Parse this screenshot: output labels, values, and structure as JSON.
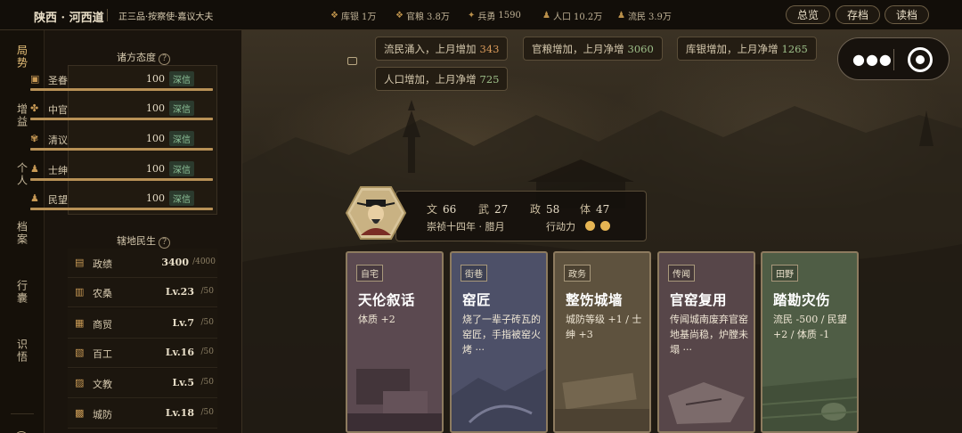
{
  "topbar": {
    "location": "陕西 · 河西道",
    "rank": "正三品·按察使·嘉议大夫",
    "resources": [
      {
        "icon": "coin-icon",
        "label": "库银",
        "value": "1万"
      },
      {
        "icon": "grain-icon",
        "label": "官粮",
        "value": "3.8万"
      },
      {
        "icon": "soldier-icon",
        "label": "兵勇",
        "value": "1590"
      },
      {
        "icon": "people-icon",
        "label": "人口",
        "value": "10.2万"
      },
      {
        "icon": "refugee-icon",
        "label": "流民",
        "value": "3.9万"
      }
    ],
    "buttons": {
      "overview": "总览",
      "save": "存档",
      "load": "读档"
    }
  },
  "nav": [
    "局势",
    "增益",
    "个人",
    "档案",
    "行囊",
    "识悟"
  ],
  "attitudes": {
    "title": "诸方态度",
    "items": [
      {
        "name": "圣眷",
        "value": "100",
        "badge": "深信",
        "level": 1.0
      },
      {
        "name": "中官",
        "value": "100",
        "badge": "深信",
        "level": 1.0
      },
      {
        "name": "清议",
        "value": "100",
        "badge": "深信",
        "level": 1.0
      },
      {
        "name": "士绅",
        "value": "100",
        "badge": "深信",
        "level": 1.0
      },
      {
        "name": "民望",
        "value": "100",
        "badge": "深信",
        "level": 1.0
      }
    ]
  },
  "livelihood": {
    "title": "辖地民生",
    "items": [
      {
        "name": "政绩",
        "value": "3400",
        "max": "/4000"
      },
      {
        "name": "农桑",
        "value": "Lv.23",
        "max": "/50"
      },
      {
        "name": "商贸",
        "value": "Lv.7",
        "max": "/50"
      },
      {
        "name": "百工",
        "value": "Lv.16",
        "max": "/50"
      },
      {
        "name": "文教",
        "value": "Lv.5",
        "max": "/50"
      },
      {
        "name": "城防",
        "value": "Lv.18",
        "max": "/50"
      }
    ]
  },
  "notices": [
    {
      "text": "流民涌入，上月增加",
      "num": "343"
    },
    {
      "text": "官粮增加，上月净增",
      "num": "3060"
    },
    {
      "text": "库银增加，上月净增",
      "num": "1265"
    },
    {
      "text": "人口增加，上月净增",
      "num": "725"
    }
  ],
  "character": {
    "stats": [
      {
        "label": "文",
        "value": "66"
      },
      {
        "label": "武",
        "value": "27"
      },
      {
        "label": "政",
        "value": "58"
      },
      {
        "label": "体",
        "value": "47"
      }
    ],
    "date": "崇祯十四年 · 腊月",
    "action_label": "行动力",
    "action_points": 2
  },
  "cards": [
    {
      "tag": "自宅",
      "title": "天伦叙话",
      "desc": "体质 +2",
      "color": "#5b4950"
    },
    {
      "tag": "街巷",
      "title": "窑匠",
      "desc": "烧了一辈子砖瓦的窑匠，手指被窑火烤 ···",
      "color": "#4d5068"
    },
    {
      "tag": "政务",
      "title": "整饬城墙",
      "desc": "城防等级 +1 / 士绅 +3",
      "color": "#5e523e"
    },
    {
      "tag": "传闻",
      "title": "官窑复用",
      "desc": "传闻城南废弃官窑地基尚稳，炉膛未塌 ···",
      "color": "#574649"
    },
    {
      "tag": "田野",
      "title": "踏勘灾伤",
      "desc": "流民 -500 / 民望 +2 / 体质 -1",
      "color": "#4f5d45"
    }
  ],
  "colors": {
    "accent": "#e9c27a",
    "positive": "#9ec08a",
    "badge": "#8fc49a"
  }
}
